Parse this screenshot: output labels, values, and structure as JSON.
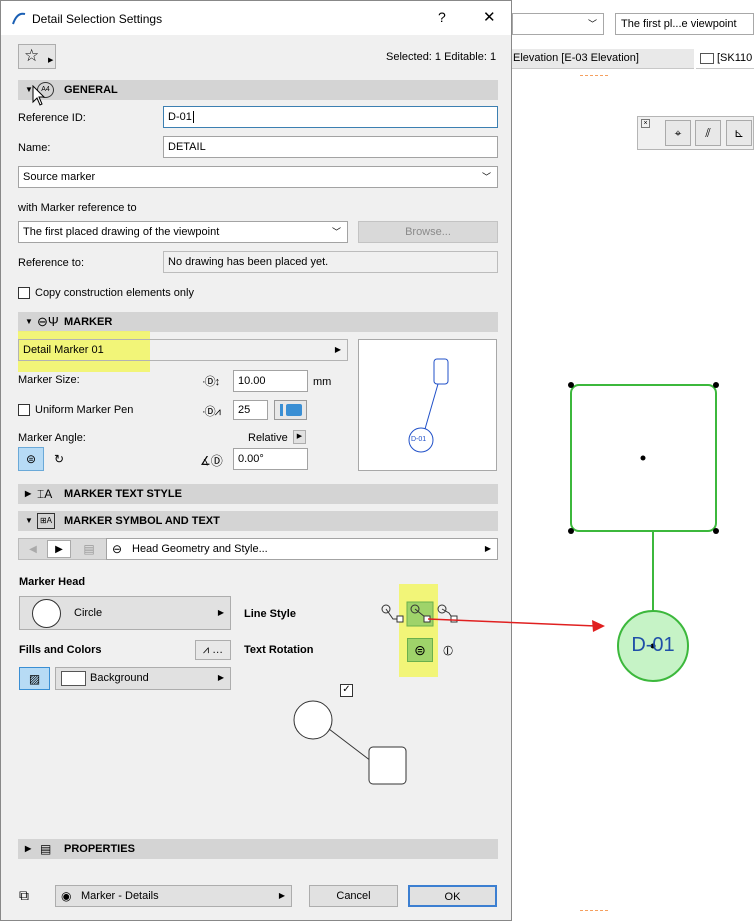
{
  "window": {
    "title": "Detail Selection Settings",
    "help_glyph": "?",
    "close_glyph": "✕"
  },
  "toolbar": {
    "favorites_icon": "star-icon",
    "selection_status": "Selected: 1 Editable: 1"
  },
  "general": {
    "header": "GENERAL",
    "reference_id_label": "Reference ID:",
    "reference_id_value": "D-01",
    "name_label": "Name:",
    "name_value": "DETAIL",
    "source_marker": "Source marker",
    "with_marker_ref_label": "with Marker reference to",
    "marker_ref_value": "The first placed drawing of the viewpoint",
    "browse_label": "Browse...",
    "reference_to_label": "Reference to:",
    "reference_to_value": "No drawing has been placed yet.",
    "copy_construction_label": "Copy construction elements only"
  },
  "marker": {
    "header": "MARKER",
    "type": "Detail Marker 01",
    "size_label": "Marker Size:",
    "size_value": "10.00",
    "size_unit": "mm",
    "uniform_pen_label": "Uniform Marker Pen",
    "pen_value": "25",
    "angle_label": "Marker Angle:",
    "relative_label": "Relative",
    "angle_value": "0.00°",
    "preview_label": "D-01"
  },
  "marker_text_style": {
    "header": "MARKER TEXT STYLE"
  },
  "marker_symbol": {
    "header": "MARKER SYMBOL AND TEXT",
    "page_selector": "Head Geometry and Style...",
    "marker_head_label": "Marker Head",
    "head_shape": "Circle",
    "line_style_label": "Line Style",
    "fills_label": "Fills and Colors",
    "fill_value": "Background",
    "text_rotation_label": "Text Rotation"
  },
  "properties": {
    "header": "PROPERTIES"
  },
  "footer": {
    "layer_value": "Marker - Details",
    "cancel_label": "Cancel",
    "ok_label": "OK"
  },
  "background_app": {
    "view_combo": "The first pl...e viewpoint",
    "tab_elevation": "Elevation [E-03 Elevation]",
    "tab_sk": "[SK110",
    "canvas_marker_label": "D-01",
    "marker_color": "#3cb83c",
    "arrow_color": "#e02020"
  }
}
